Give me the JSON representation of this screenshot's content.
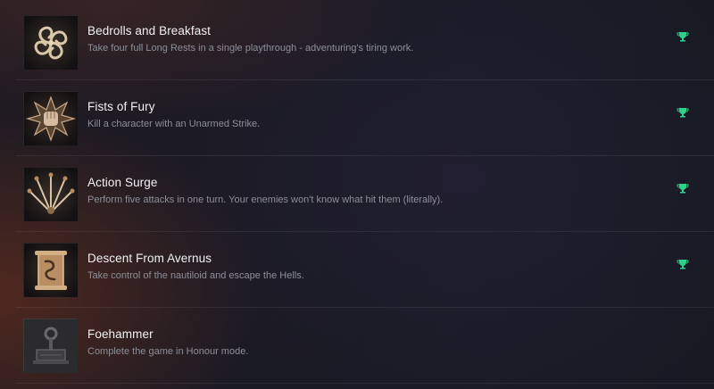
{
  "achievements": [
    {
      "title": "Bedrolls and Breakfast",
      "description": "Take four full Long Rests in a single playthrough - adventuring's tiring work.",
      "icon": "bedroll-spiral-icon",
      "unlocked": true
    },
    {
      "title": "Fists of Fury",
      "description": "Kill a character with an Unarmed Strike.",
      "icon": "fist-icon",
      "unlocked": true
    },
    {
      "title": "Action Surge",
      "description": "Perform five attacks in one turn. Your enemies won't know what hit them (literally).",
      "icon": "swords-fan-icon",
      "unlocked": true
    },
    {
      "title": "Descent From Avernus",
      "description": "Take control of the nautiloid and escape the Hells.",
      "icon": "scroll-icon",
      "unlocked": true
    },
    {
      "title": "Foehammer",
      "description": "Complete the game in Honour mode.",
      "icon": "hammer-icon",
      "unlocked": false
    }
  ],
  "colors": {
    "trophy": "#2fd08a",
    "title": "#f1f1f3",
    "description": "#8d8f99"
  }
}
